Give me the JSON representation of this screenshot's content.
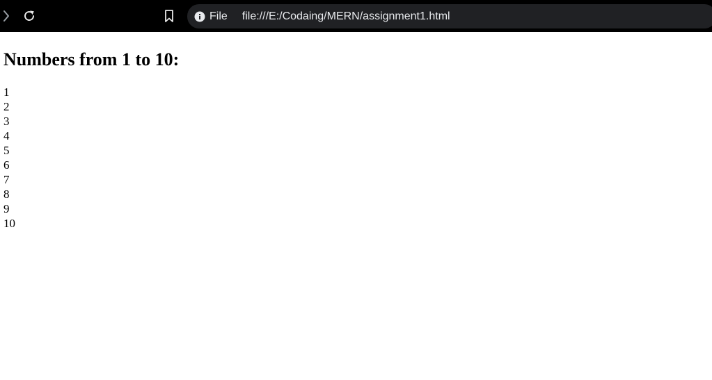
{
  "browser": {
    "forward_icon": "chevron-right-icon",
    "reload_icon": "reload-icon",
    "bookmark_icon": "bookmark-icon",
    "site_info_icon": "info-icon",
    "site_info_label": "File",
    "url": "file:///E:/Codaing/MERN/assignment1.html"
  },
  "page": {
    "heading": "Numbers from 1 to 10:",
    "numbers": [
      "1",
      "2",
      "3",
      "4",
      "5",
      "6",
      "7",
      "8",
      "9",
      "10"
    ]
  },
  "colors": {
    "toolbar_bg": "#000000",
    "omnibox_bg": "#202124",
    "toolbar_text": "#e8eaed",
    "page_bg": "#ffffff",
    "page_text": "#000000"
  }
}
